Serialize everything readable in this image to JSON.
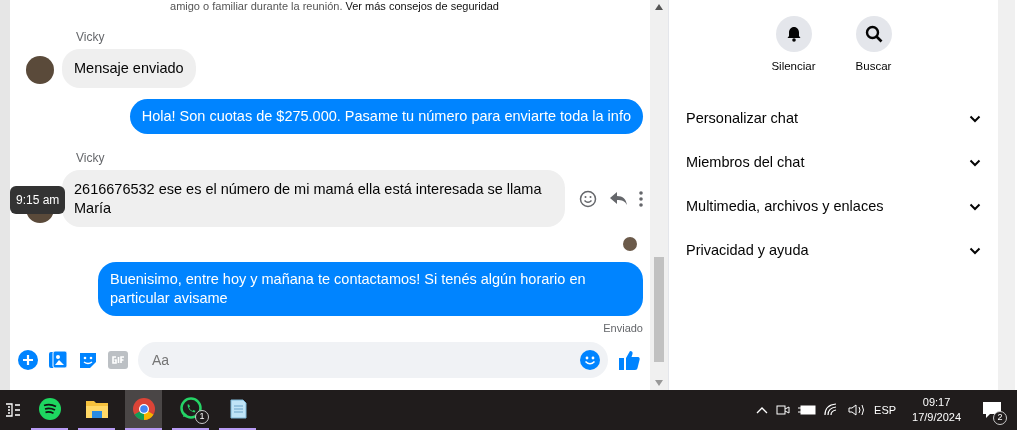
{
  "notice": {
    "text": "amigo o familiar durante la reunión.",
    "link": "Ver más consejos de seguridad"
  },
  "messages": [
    {
      "kind": "sender",
      "text": "Vicky"
    },
    {
      "kind": "incoming",
      "text": "Mensaje enviado"
    },
    {
      "kind": "outgoing",
      "text": "Hola! Son cuotas de $275.000. Pasame tu número para enviarte toda la info"
    },
    {
      "kind": "sender",
      "text": "Vicky"
    },
    {
      "kind": "incoming",
      "text": "2616676532 ese es el número de mi mamá ella está interesada se llama María",
      "tooltip": "9:15 am",
      "hovered": true
    },
    {
      "kind": "seen"
    },
    {
      "kind": "outgoing",
      "text": "Buenisimo, entre hoy y mañana te contactamos! Si tenés algún horario en particular avisame"
    },
    {
      "kind": "status",
      "text": "Enviado"
    }
  ],
  "composer": {
    "placeholder": "Aa"
  },
  "panel": {
    "actions": [
      {
        "kind": "mute",
        "label": "Silenciar"
      },
      {
        "kind": "search",
        "label": "Buscar"
      }
    ],
    "sections": [
      {
        "label": "Personalizar chat",
        "expanded": false
      },
      {
        "label": "Miembros del chat",
        "expanded": false
      },
      {
        "label": "Multimedia, archivos y enlaces",
        "expanded": false
      },
      {
        "label": "Privacidad y ayuda",
        "expanded": false
      }
    ]
  },
  "taskbar": {
    "apps": [
      {
        "kind": "music",
        "selected": false
      },
      {
        "kind": "files",
        "selected": false
      },
      {
        "kind": "browser",
        "selected": true
      },
      {
        "kind": "messenger",
        "selected": false,
        "badge": "1"
      },
      {
        "kind": "notes",
        "selected": false
      }
    ],
    "language": "ESP",
    "time": "09:17",
    "date": "17/9/2024",
    "notifications": "2"
  }
}
